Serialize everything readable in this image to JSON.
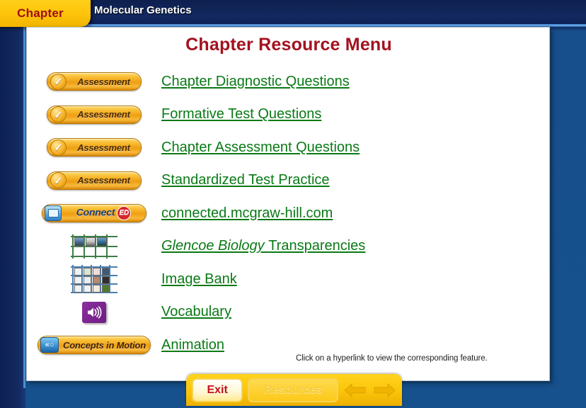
{
  "header": {
    "tab_label": "Chapter",
    "chapter_title": "Molecular Genetics"
  },
  "page": {
    "title": "Chapter Resource Menu",
    "footnote": "Click on a hyperlink to view the corresponding feature."
  },
  "resources": [
    {
      "icon": "assessment-check-icon",
      "badge_label": "Assessment",
      "link": "Chapter Diagnostic Questions",
      "link_italic_prefix": ""
    },
    {
      "icon": "assessment-check-icon",
      "badge_label": "Assessment",
      "link": "Formative Test Questions",
      "link_italic_prefix": ""
    },
    {
      "icon": "assessment-check-icon",
      "badge_label": "Assessment",
      "link": "Chapter Assessment Questions",
      "link_italic_prefix": ""
    },
    {
      "icon": "assessment-check-icon",
      "badge_label": "Assessment",
      "link": "Standardized Test Practice",
      "link_italic_prefix": ""
    },
    {
      "icon": "connect-ed-icon",
      "badge_label": "Connect",
      "badge_suffix": "ED",
      "link": "connected.mcgraw-hill.com",
      "link_italic_prefix": ""
    },
    {
      "icon": "transparencies-grid-icon",
      "badge_label": "",
      "link": "Transparencies",
      "link_italic_prefix": "Glencoe Biology "
    },
    {
      "icon": "image-bank-grid-icon",
      "badge_label": "",
      "link": "Image Bank",
      "link_italic_prefix": ""
    },
    {
      "icon": "speaker-icon",
      "badge_label": "",
      "link": "Vocabulary",
      "link_italic_prefix": ""
    },
    {
      "icon": "concepts-in-motion-icon",
      "badge_label": "Concepts in Motion",
      "link": "Animation",
      "link_italic_prefix": ""
    }
  ],
  "bottom_bar": {
    "exit_label": "Exit",
    "resources_label": "Resources",
    "back_arrow": "back-arrow-icon",
    "forward_arrow": "forward-arrow-icon"
  },
  "colors": {
    "frame_blue": "#16508d",
    "header_navy": "#0d2055",
    "tab_gold": "#fdc50b",
    "title_red": "#a2121f",
    "link_green": "#0a7a16",
    "exit_red": "#c1121f"
  }
}
